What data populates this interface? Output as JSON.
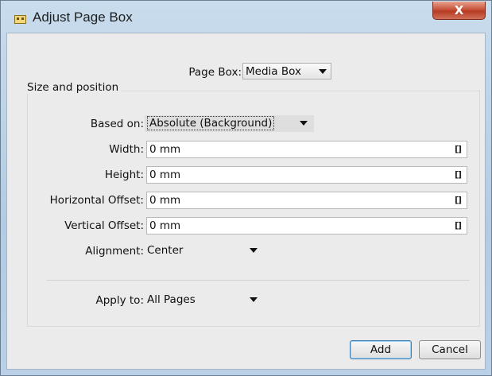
{
  "window": {
    "title": "Adjust Page Box",
    "close_label": "X"
  },
  "page_box": {
    "label": "Page Box:",
    "value": "Media Box"
  },
  "group": {
    "title": "Size and position"
  },
  "based_on": {
    "label": "Based on:",
    "value": "Absolute (Background)"
  },
  "fields": [
    {
      "label": "Width:",
      "value": "0 mm",
      "unit_icon": "[]"
    },
    {
      "label": "Height:",
      "value": "0 mm",
      "unit_icon": "[]"
    },
    {
      "label": "Horizontal Offset:",
      "value": "0 mm",
      "unit_icon": "[]"
    },
    {
      "label": "Vertical Offset:",
      "value": "0 mm",
      "unit_icon": "[]"
    }
  ],
  "alignment": {
    "label": "Alignment:",
    "value": "Center"
  },
  "apply_to": {
    "label": "Apply to:",
    "value": "All Pages"
  },
  "buttons": {
    "add": "Add",
    "cancel": "Cancel"
  }
}
